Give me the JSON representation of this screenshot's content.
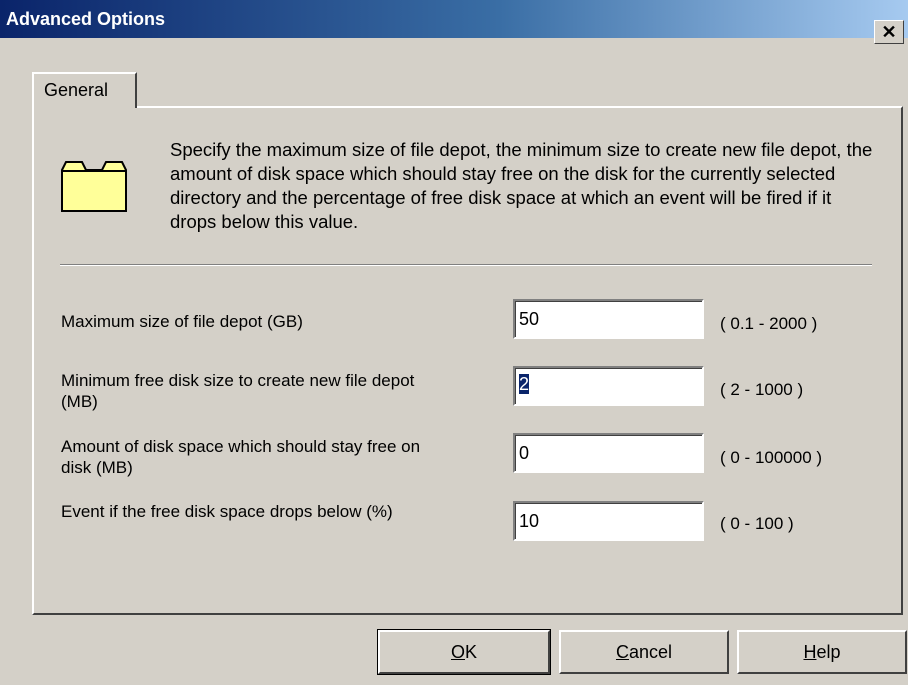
{
  "window": {
    "title": "Advanced Options",
    "close_glyph": "✕"
  },
  "tabs": [
    {
      "label": "General",
      "active": true
    }
  ],
  "general": {
    "icon": "folder-icon",
    "description": "Specify the maximum size of file depot, the minimum size to create new file depot, the amount of disk space which should stay free on the disk for the currently selected directory and the percentage of free disk space at which an event will be fired if it drops below this value.",
    "fields": [
      {
        "label": "Maximum size of file depot (GB)",
        "value": "50",
        "range": "( 0.1 - 2000 )"
      },
      {
        "label": "Minimum free disk size to create new file depot (MB)",
        "value": "2",
        "range": "( 2 - 1000 )"
      },
      {
        "label": "Amount of disk space which should stay free on disk (MB)",
        "value": "0",
        "range": "( 0 - 100000 )"
      },
      {
        "label": "Event if the free disk space drops below (%)",
        "value": "10",
        "range": "( 0 - 100 )"
      }
    ]
  },
  "buttons": {
    "ok": {
      "accel": "O",
      "rest": "K"
    },
    "cancel": {
      "accel": "C",
      "rest": "ancel"
    },
    "help": {
      "accel": "H",
      "rest": "elp"
    }
  },
  "colors": {
    "titlebar_start": "#0a246a",
    "titlebar_end": "#a6caf0",
    "dialog_bg": "#d4d0c8",
    "selection": "#0a246a",
    "folder_fill": "#ffff99"
  }
}
